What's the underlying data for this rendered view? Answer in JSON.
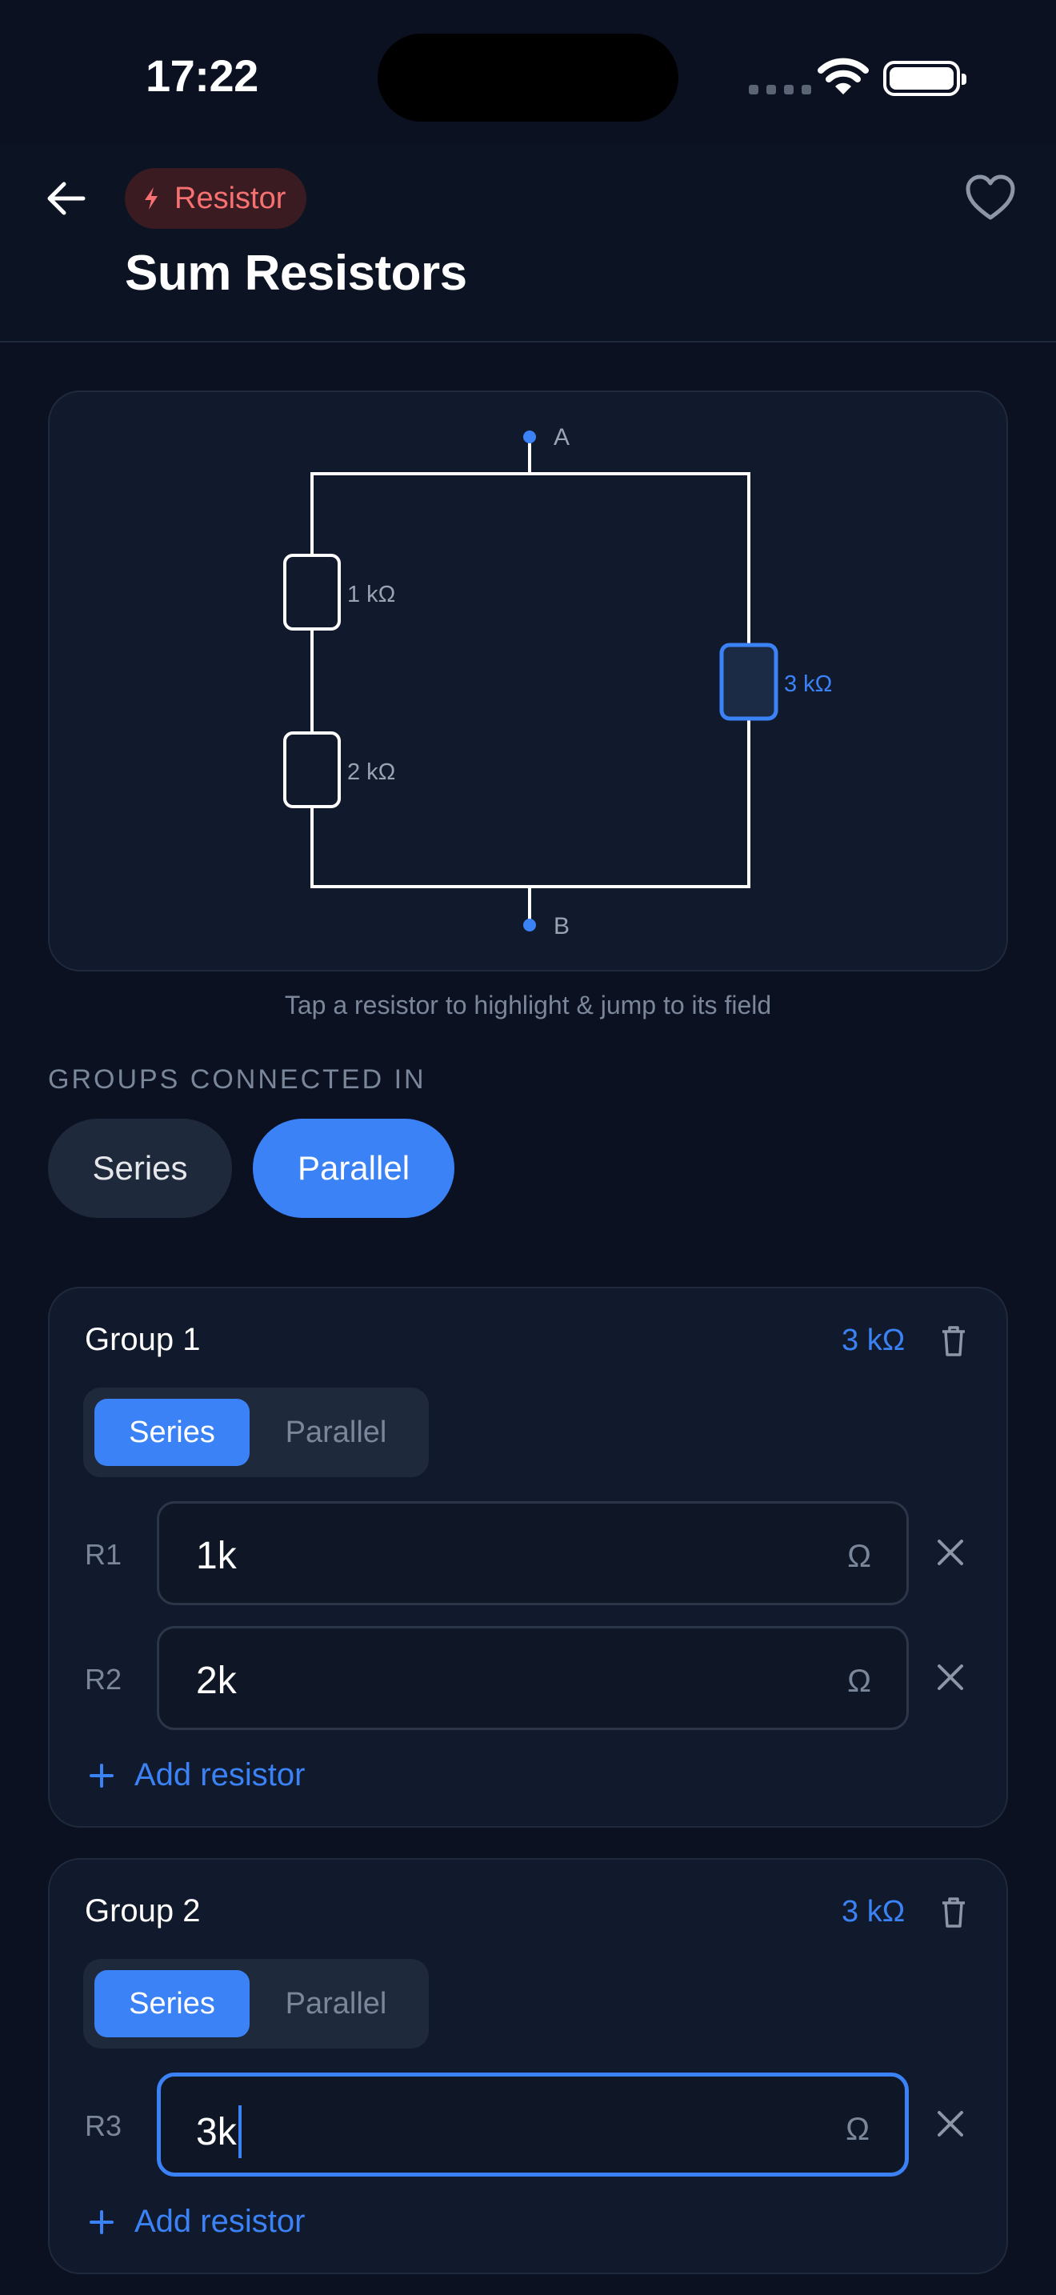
{
  "status_bar": {
    "time": "17:22"
  },
  "header": {
    "category_chip": "Resistor",
    "title": "Sum Resistors"
  },
  "circuit": {
    "node_a": "A",
    "node_b": "B",
    "resistors": [
      {
        "label": "1 kΩ",
        "highlighted": false
      },
      {
        "label": "2 kΩ",
        "highlighted": false
      },
      {
        "label": "3 kΩ",
        "highlighted": true
      }
    ],
    "hint": "Tap a resistor to highlight & jump to its field"
  },
  "connection": {
    "section_label": "GROUPS CONNECTED IN",
    "options": [
      "Series",
      "Parallel"
    ],
    "selected": "Parallel"
  },
  "groups": [
    {
      "title": "Group 1",
      "total": "3 kΩ",
      "mode_options": [
        "Series",
        "Parallel"
      ],
      "mode_selected": "Series",
      "resistors": [
        {
          "label": "R1",
          "value": "1k",
          "unit": "Ω"
        },
        {
          "label": "R2",
          "value": "2k",
          "unit": "Ω"
        }
      ],
      "add_label": "Add resistor"
    },
    {
      "title": "Group 2",
      "total": "3 kΩ",
      "mode_options": [
        "Series",
        "Parallel"
      ],
      "mode_selected": "Series",
      "resistors": [
        {
          "label": "R3",
          "value": "3k",
          "unit": "Ω",
          "focused": true
        }
      ],
      "add_label": "Add resistor"
    }
  ],
  "colors": {
    "background": "#0b1120",
    "card": "#111a2c",
    "accent": "#3b82f6",
    "chip_text": "#f87171",
    "muted": "#7a8699"
  }
}
